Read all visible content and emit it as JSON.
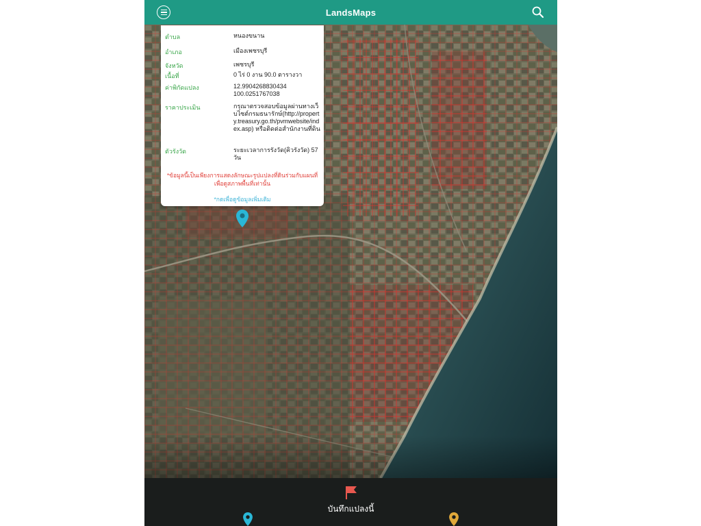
{
  "app": {
    "title": "LandsMaps",
    "accent_color": "#1f9a85"
  },
  "header": {
    "menu_icon": "menu-icon",
    "search_icon": "search-icon"
  },
  "popup": {
    "rows": [
      {
        "label": "ตำบล",
        "value": "หนองขนาน"
      },
      {
        "label": "อำเภอ",
        "value": "เมืองเพชรบุรี"
      },
      {
        "label": "จังหวัด",
        "value": "เพชรบุรี"
      },
      {
        "label": "เนื้อที่",
        "value": "0 ไร่ 0 งาน 90.0 ตารางวา"
      },
      {
        "label": "ค่าพิกัดแปลง",
        "value": "12.9904268830434 100.0251767038"
      },
      {
        "label": "ราคาประเมิน",
        "value": "กรุณาตรวจสอบข้อมูลผ่านทางเว็บไซต์กรมธนารักษ์(http://property.treasury.go.th/pvmwebsite/index.asp) หรือติดต่อสำนักงานที่ดิน"
      },
      {
        "label": "ตัวรังวัด",
        "value": "ระยะเวลาการรังวัด(คิวรังวัด) 57 วัน"
      }
    ],
    "note": "*ข้อมูลนี้เป็นเพียงการแสดงลักษณะรูปแปลงที่ดินร่วมกับแผนที่เพื่อดูสภาพพื้นที่เท่านั้น",
    "more_link": "*กดเพื่อดูข้อมูลเพิ่มเติม",
    "label_color": "#3aa64a",
    "note_color": "#e0403a",
    "link_color": "#3fb4d8"
  },
  "map": {
    "marker_icon": "map-pin-icon",
    "marker_color": "#2ab7d6",
    "parcel_line_color": "#e0302a"
  },
  "bottom_bar": {
    "save_label": "บันทึกแปลงนี้",
    "flag_icon": "flag-icon",
    "flag_color": "#e8584f",
    "left_pin_color": "#2ab7d6",
    "right_pin_color": "#e0a83a"
  }
}
